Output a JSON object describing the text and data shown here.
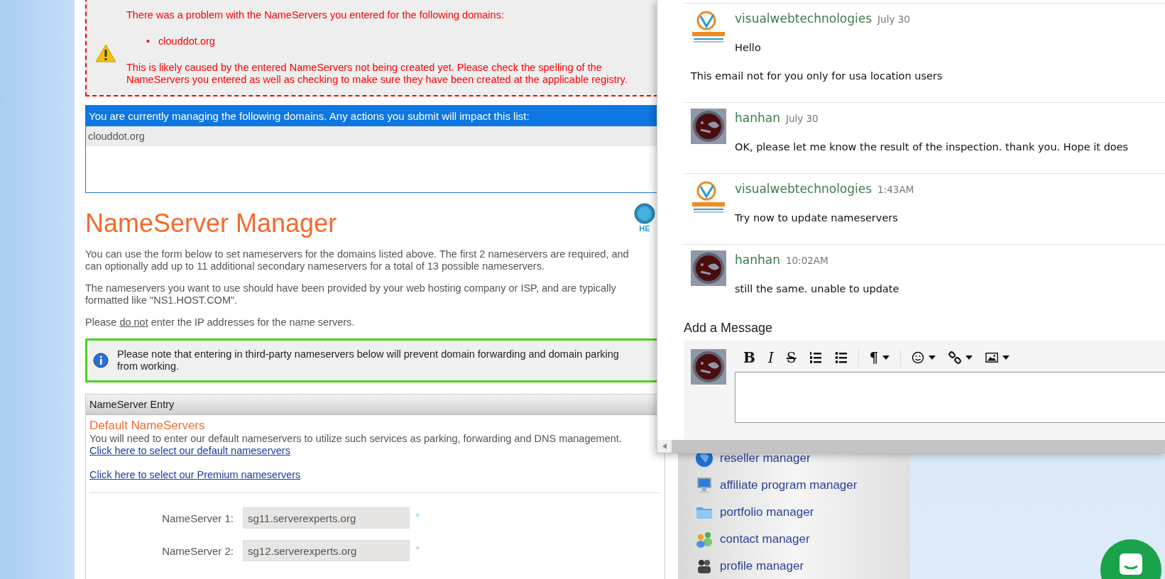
{
  "error_box": {
    "heading": "There was a problem with the NameServers you entered for the following domains:",
    "domains": [
      {
        "marker": "•",
        "name": "clouddot.org"
      }
    ],
    "detail": "This is likely caused by the entered NameServers not being created yet. Please check the spelling of the NameServers you entered as well as checking to make sure they have been created at the applicable registry."
  },
  "managed_domains": {
    "header": "You are currently managing the following domains. Any actions you submit will impact this list:",
    "domains": [
      "clouddot.org"
    ]
  },
  "page_title": "NameServer Manager",
  "help_button": {
    "label": "HE"
  },
  "intro_lines": [
    "You can use the form below to set nameservers for the domains listed above. The first 2 nameservers are required, and",
    "can optionally add up to 11 additional secondary nameservers for a total of 13 possible nameservers."
  ],
  "hosting_note": "The nameservers you want to use should have been provided by your web hosting company or ISP, and are typically formatted like \"NS1.HOST.COM\".",
  "ip_note": {
    "before": "Please",
    "emphasis": "do not",
    "after": "enter the IP addresses for the name servers."
  },
  "info_note": "Please note that entering in third-party nameservers below will prevent domain forwarding and domain parking from working.",
  "entry_panel": {
    "header": "NameServer Entry",
    "section_title": "Default NameServers",
    "description": "You will need to enter our default nameservers to utilize such services as parking, forwarding and DNS management.",
    "links": [
      "Click here to select our default nameservers",
      "Click here to select our Premium nameservers"
    ],
    "fields": [
      {
        "label": "NameServer 1:",
        "value": "sg11.serverexperts.org",
        "required_mark": "*"
      },
      {
        "label": "NameServer 2:",
        "value": "sg12.serverexperts.org",
        "required_mark": "*"
      }
    ]
  },
  "sidebar": {
    "items": [
      {
        "label": "reseller manager",
        "kind": "globe"
      },
      {
        "label": "affiliate program manager",
        "kind": "monitor"
      },
      {
        "label": "portfolio manager",
        "kind": "folder"
      },
      {
        "label": "contact manager",
        "kind": "people"
      },
      {
        "label": "profile manager",
        "kind": "person"
      }
    ]
  },
  "chat": {
    "messages": [
      {
        "author": "visualwebtechnologies",
        "kind": "logo",
        "time": "July 30",
        "paragraphs": [
          "Hello",
          "This email not for you only for usa location users"
        ]
      },
      {
        "author": "hanhan",
        "kind": "user",
        "time": "July 30",
        "paragraphs": [
          "OK, please let me know the result of the inspection. thank you. Hope it does"
        ]
      },
      {
        "author": "visualwebtechnologies",
        "kind": "logo",
        "time": "1:43AM",
        "paragraphs": [
          "Try now to update nameservers"
        ]
      },
      {
        "author": "hanhan",
        "kind": "user",
        "time": "10:02AM",
        "paragraphs": [
          "still the same. unable to update"
        ]
      }
    ],
    "compose": {
      "title": "Add a Message",
      "toolbar": [
        {
          "kind": "bold",
          "glyph": "B",
          "dropdown": false
        },
        {
          "kind": "italic",
          "glyph": "I",
          "dropdown": false
        },
        {
          "kind": "strike",
          "glyph": "S",
          "dropdown": false
        },
        {
          "kind": "ordered-list",
          "dropdown": false
        },
        {
          "kind": "bullet-list",
          "dropdown": false
        },
        {
          "kind": "separator"
        },
        {
          "kind": "paragraph",
          "glyph": "¶",
          "dropdown": true
        },
        {
          "kind": "separator"
        },
        {
          "kind": "emoji",
          "dropdown": true
        },
        {
          "kind": "link",
          "dropdown": true
        },
        {
          "kind": "image",
          "dropdown": true
        }
      ]
    }
  }
}
